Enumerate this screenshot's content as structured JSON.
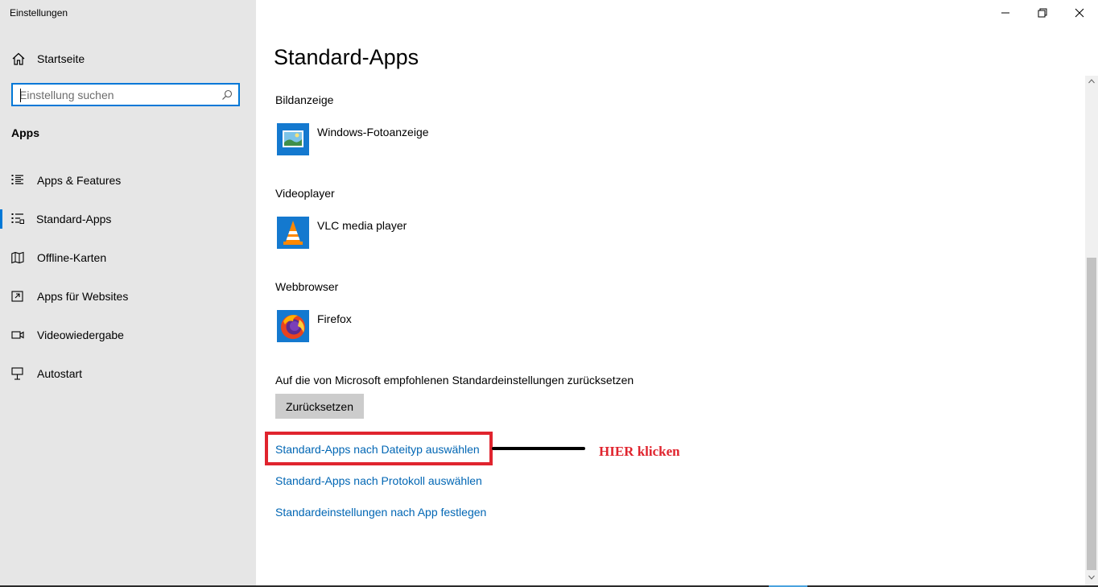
{
  "window": {
    "title": "Einstellungen"
  },
  "sidebar": {
    "home_label": "Startseite",
    "search_placeholder": "Einstellung suchen",
    "section_heading": "Apps",
    "items": [
      {
        "label": "Apps & Features",
        "icon": "list-icon"
      },
      {
        "label": "Standard-Apps",
        "icon": "default-apps-icon",
        "active": true
      },
      {
        "label": "Offline-Karten",
        "icon": "map-icon"
      },
      {
        "label": "Apps für Websites",
        "icon": "website-app-icon"
      },
      {
        "label": "Videowiedergabe",
        "icon": "video-icon"
      },
      {
        "label": "Autostart",
        "icon": "startup-icon"
      }
    ]
  },
  "main": {
    "title": "Standard-Apps",
    "groups": [
      {
        "label": "Bildanzeige",
        "app": "Windows-Fotoanzeige",
        "icon": "photo-viewer-icon"
      },
      {
        "label": "Videoplayer",
        "app": "VLC media player",
        "icon": "vlc-icon"
      },
      {
        "label": "Webbrowser",
        "app": "Firefox",
        "icon": "firefox-icon"
      }
    ],
    "reset_text": "Auf die von Microsoft empfohlenen Standardeinstellungen zurücksetzen",
    "reset_button": "Zurücksetzen",
    "links": [
      "Standard-Apps nach Dateityp auswählen",
      "Standard-Apps nach Protokoll auswählen",
      "Standardeinstellungen nach App festlegen"
    ]
  },
  "annotation": {
    "text": "HIER klicken"
  },
  "colors": {
    "accent": "#0078d7",
    "link": "#0066b4",
    "annotation": "#e0242e",
    "sidebar_bg": "#e6e6e6"
  }
}
